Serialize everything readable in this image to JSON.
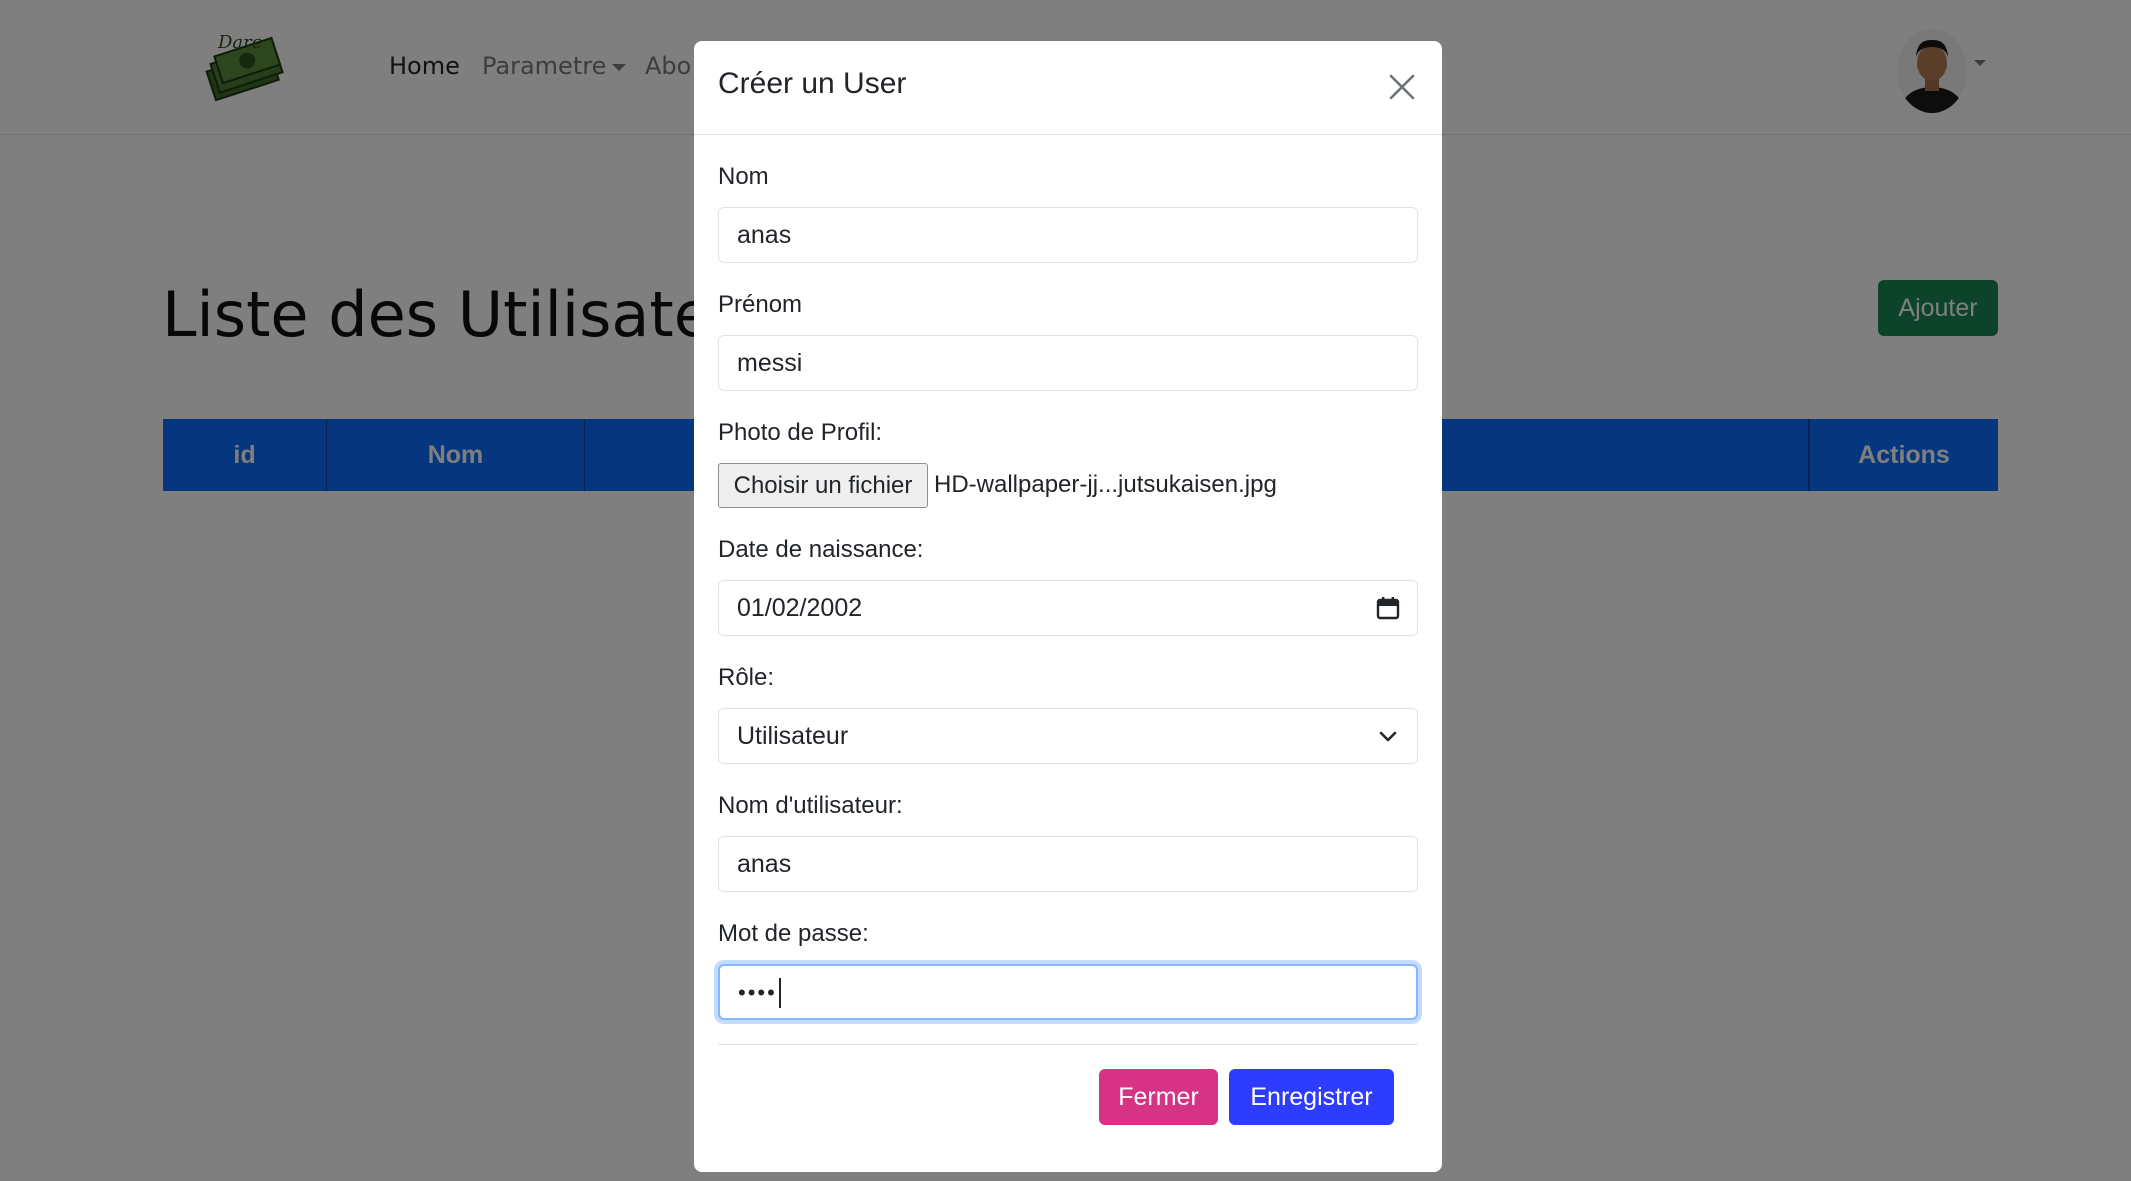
{
  "navbar": {
    "home": "Home",
    "parametre": "Parametre",
    "about_partial": "Abo"
  },
  "page": {
    "title": "Liste des Utilisateurs",
    "add_button": "Ajouter",
    "table_headers": [
      "id",
      "Nom",
      "Actions"
    ]
  },
  "modal": {
    "title": "Créer un User",
    "fields": {
      "nom": {
        "label": "Nom",
        "value": "anas"
      },
      "prenom": {
        "label": "Prénom",
        "value": "messi"
      },
      "photo": {
        "label": "Photo de Profil:",
        "button": "Choisir un fichier",
        "file_name": "HD-wallpaper-jj...jutsukaisen.jpg"
      },
      "date": {
        "label": "Date de naissance:",
        "value": "01/02/2002"
      },
      "role": {
        "label": "Rôle:",
        "value": "Utilisateur"
      },
      "username": {
        "label": "Nom d'utilisateur:",
        "value": "anas"
      },
      "password": {
        "label": "Mot de passe:",
        "value": "••••"
      }
    },
    "buttons": {
      "close": "Fermer",
      "save": "Enregistrer"
    }
  },
  "colors": {
    "primary": "#0d6efd",
    "success": "#198754",
    "pink": "#d63384",
    "blue_save": "#2d3cfe"
  }
}
